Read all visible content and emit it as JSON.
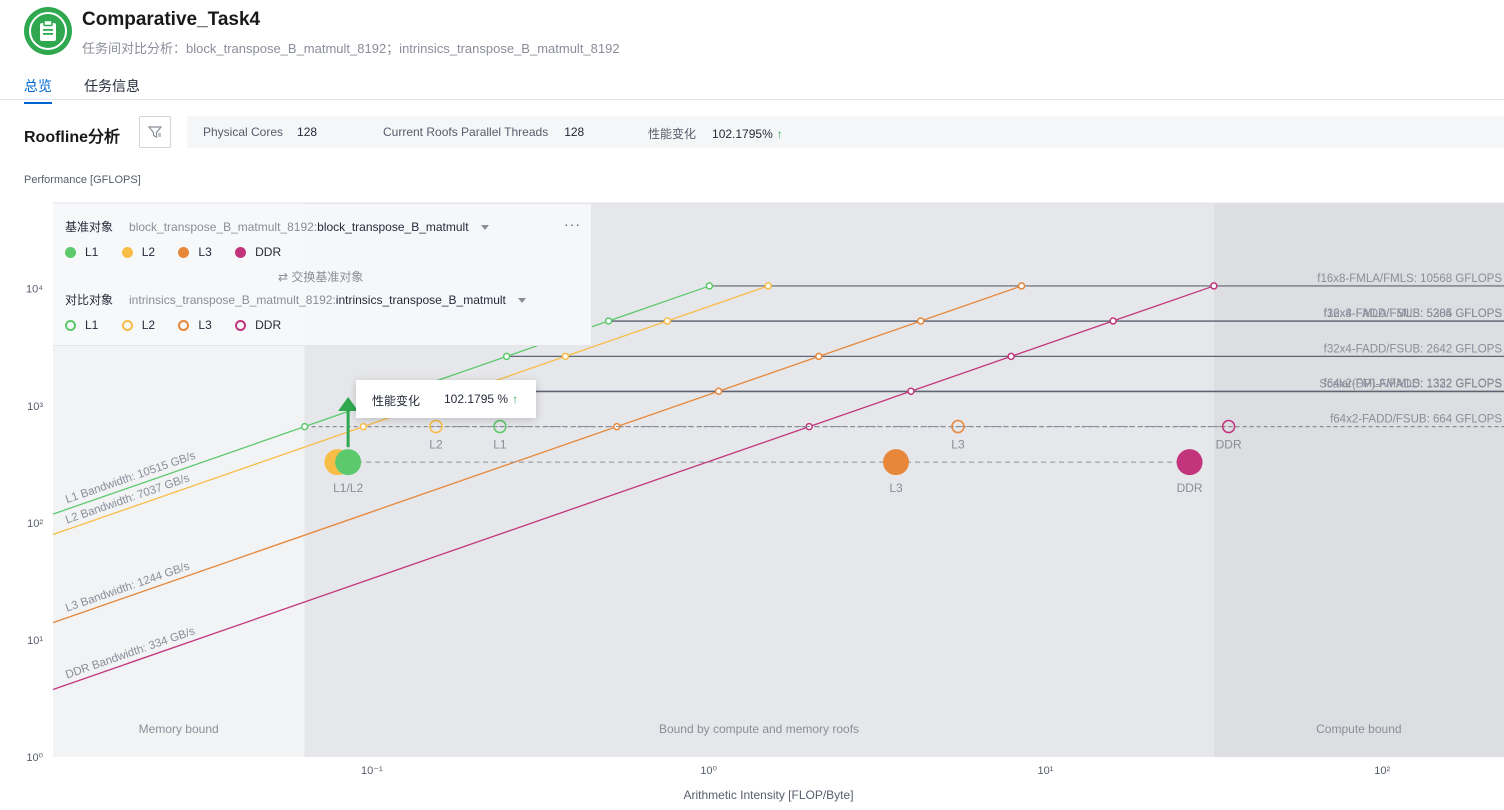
{
  "header": {
    "title": "Comparative_Task4",
    "subtitle": "任务间对比分析：block_transpose_B_matmult_8192；intrinsics_transpose_B_matmult_8192",
    "accent": "#2fa84f"
  },
  "tabs": [
    {
      "label": "总览",
      "active": true
    },
    {
      "label": "任务信息",
      "active": false
    }
  ],
  "section": {
    "title": "Roofline分析",
    "filter_icon": "filter-icon"
  },
  "stats": {
    "physical_cores_label": "Physical Cores",
    "physical_cores_value": "128",
    "threads_label": "Current Roofs Parallel Threads",
    "threads_value": "128",
    "perf_change_label": "性能变化",
    "perf_change_value": "102.1795%",
    "perf_change_arrow": "↑"
  },
  "legend": {
    "baseline_label": "基准对象",
    "baseline_task": "block_transpose_B_matmult_8192:",
    "baseline_func": "block_transpose_B_matmult",
    "compare_label": "对比对象",
    "compare_task": "intrinsics_transpose_B_matmult_8192:",
    "compare_func": "intrinsics_transpose_B_matmult",
    "swap_label": "交换基准对象",
    "more": "···",
    "items": [
      {
        "name": "L1",
        "color": "#5cc96d"
      },
      {
        "name": "L2",
        "color": "#f7bd47"
      },
      {
        "name": "L3",
        "color": "#e6873a"
      },
      {
        "name": "DDR",
        "color": "#c2357c"
      }
    ]
  },
  "tooltip": {
    "label": "性能变化",
    "value": "102.1795 %",
    "arrow": "↑"
  },
  "chart_data": {
    "type": "line",
    "ylabel": "Performance [GFLOPS]",
    "xlabel": "Arithmetic Intensity [FLOP/Byte]",
    "x_scale": "log",
    "y_scale": "log",
    "xlim": [
      0.0113,
      230
    ],
    "ylim": [
      1,
      54000
    ],
    "x_ticks": [
      {
        "value": 0.1,
        "label": "10⁻¹"
      },
      {
        "value": 1,
        "label": "10⁰"
      },
      {
        "value": 10,
        "label": "10¹"
      },
      {
        "value": 100,
        "label": "10²"
      }
    ],
    "y_ticks": [
      {
        "value": 1,
        "label": "10⁰"
      },
      {
        "value": 10,
        "label": "10¹"
      },
      {
        "value": 100,
        "label": "10²"
      },
      {
        "value": 1000,
        "label": "10³"
      },
      {
        "value": 10000,
        "label": "10⁴"
      }
    ],
    "regions": [
      {
        "label": "Memory bound",
        "x_from": 0.0113,
        "x_to": 0.063,
        "color": "#f2f3f5"
      },
      {
        "label": "Bound by compute and memory roofs",
        "x_from": 0.063,
        "x_to": 31.6,
        "color": "#e6e7ea"
      },
      {
        "label": "Compute bound",
        "x_from": 31.6,
        "x_to": 230,
        "color": "#dcdee2"
      }
    ],
    "bandwidths": [
      {
        "name": "L1 Bandwidth: 10515 GB/s",
        "gbps": 10515,
        "color": "#5cc96d"
      },
      {
        "name": "L2 Bandwidth: 7037 GB/s",
        "gbps": 7037,
        "color": "#f7bd47"
      },
      {
        "name": "L3 Bandwidth: 1244 GB/s",
        "gbps": 1244,
        "color": "#e6873a"
      },
      {
        "name": "DDR Bandwidth: 334 GB/s",
        "gbps": 334,
        "color": "#c2357c"
      }
    ],
    "roofs": [
      {
        "name": "f16x8-FMLA/FMLS: 10568 GFLOPS",
        "gflops": 10568
      },
      {
        "name": "f16x8-FADD/FSUB: 5305 GFLOPS",
        "gflops": 5305
      },
      {
        "name": "f32x4-FMLA/FMLS: 5284 GFLOPS",
        "gflops": 5284
      },
      {
        "name": "f32x4-FADD/FSUB: 2642 GFLOPS",
        "gflops": 2642
      },
      {
        "name": "f64x2-FMLA/FMLS: 1332 GFLOPS",
        "gflops": 1332
      },
      {
        "name": "Scalar(DP)-FMADD: 1322 GFLOPS",
        "gflops": 1322
      },
      {
        "name": "f64x2-FADD/FSUB: 664 GFLOPS",
        "gflops": 664
      }
    ],
    "baseline_points": [
      {
        "label": "L1/L2",
        "series": "L1",
        "x": 0.085,
        "y": 330,
        "color": "#5cc96d"
      },
      {
        "label": "",
        "series": "L2",
        "x": 0.079,
        "y": 330,
        "color": "#f7bd47"
      },
      {
        "label": "L3",
        "series": "L3",
        "x": 3.6,
        "y": 330,
        "color": "#e6873a"
      },
      {
        "label": "DDR",
        "series": "DDR",
        "x": 26.8,
        "y": 330,
        "color": "#c2357c"
      }
    ],
    "compare_points": [
      {
        "label": "L1",
        "series": "L1",
        "x": 0.24,
        "y": 665,
        "color": "#5cc96d"
      },
      {
        "label": "L2",
        "series": "L2",
        "x": 0.155,
        "y": 665,
        "color": "#f7bd47"
      },
      {
        "label": "L3",
        "series": "L3",
        "x": 5.5,
        "y": 665,
        "color": "#e6873a"
      },
      {
        "label": "DDR",
        "series": "DDR",
        "x": 35,
        "y": 665,
        "color": "#c2357c"
      }
    ],
    "improvement_arrow_color": "#2fa84f"
  }
}
